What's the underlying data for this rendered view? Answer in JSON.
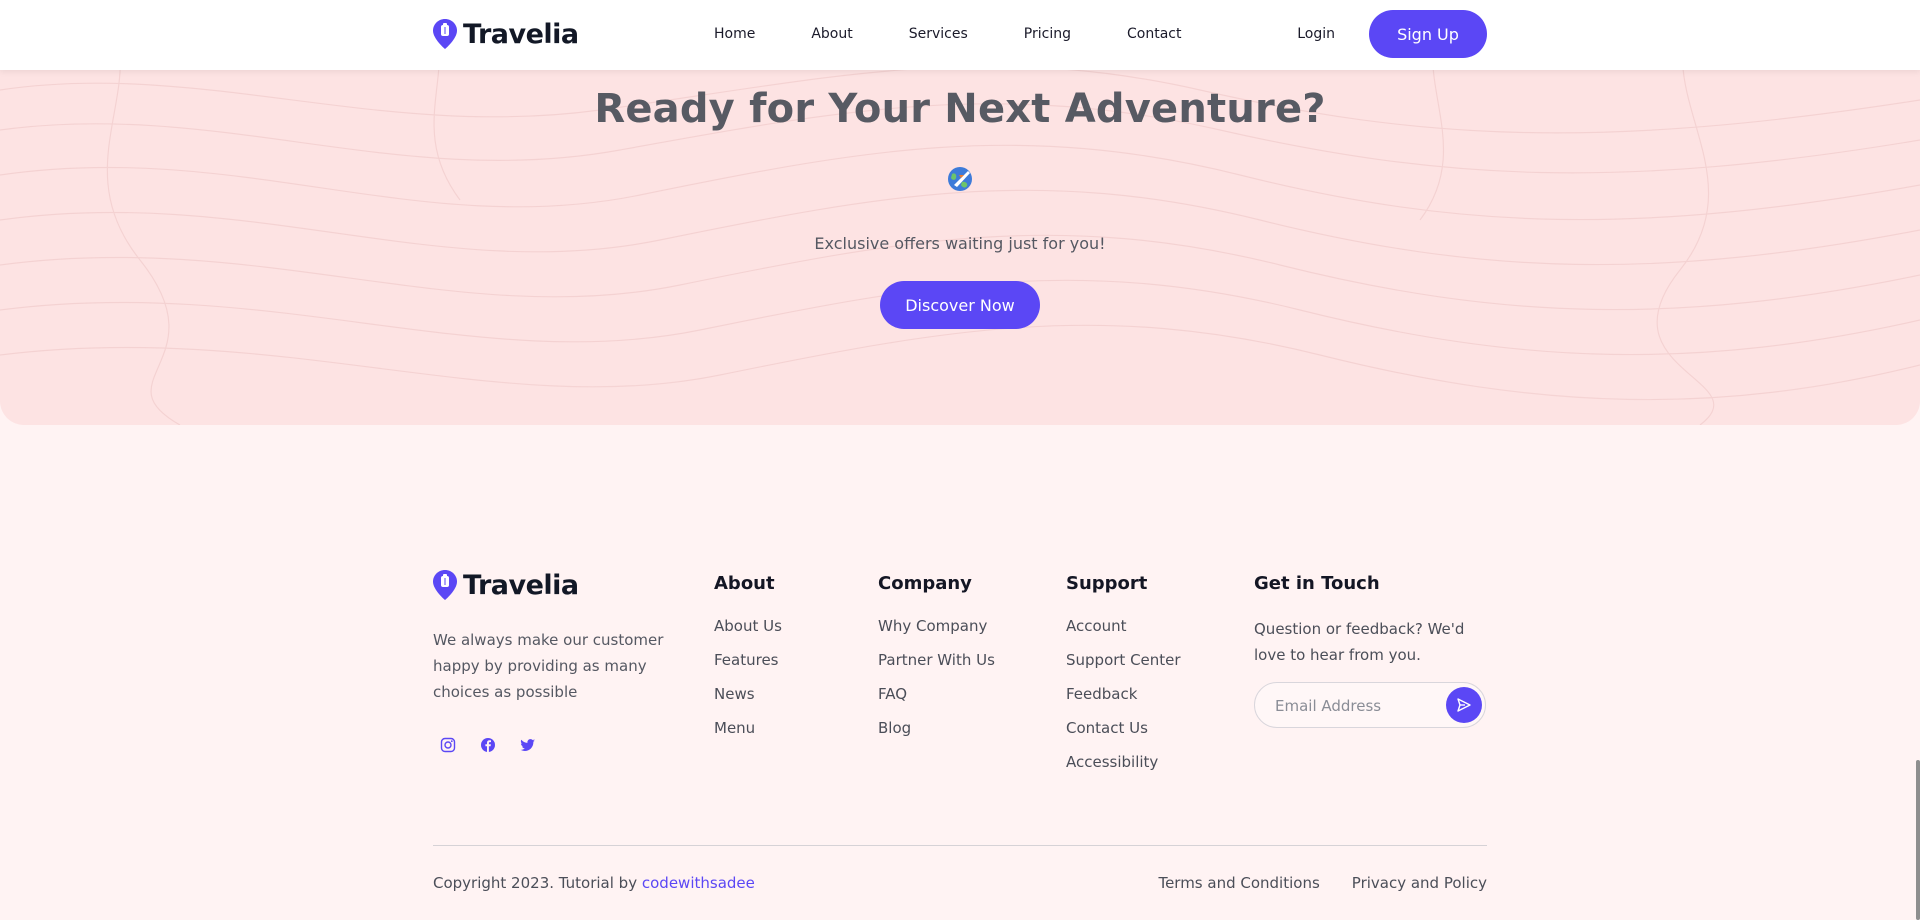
{
  "brand": {
    "name": "Travelia",
    "accent": "#5b47f5"
  },
  "header": {
    "nav": [
      "Home",
      "About",
      "Services",
      "Pricing",
      "Contact"
    ],
    "login": "Login",
    "signup": "Sign Up"
  },
  "cta": {
    "title": "Ready for Your Next Adventure?",
    "icon": "globe-airplane-icon",
    "subtitle": "Exclusive offers waiting just for you!",
    "button": "Discover Now"
  },
  "footer": {
    "description": "We always make our customer happy by providing as many choices as possible",
    "socials": [
      "instagram-icon",
      "facebook-icon",
      "twitter-icon"
    ],
    "about": {
      "title": "About",
      "links": [
        "About Us",
        "Features",
        "News",
        "Menu"
      ]
    },
    "company": {
      "title": "Company",
      "links": [
        "Why Company",
        "Partner With Us",
        "FAQ",
        "Blog"
      ]
    },
    "support": {
      "title": "Support",
      "links": [
        "Account",
        "Support Center",
        "Feedback",
        "Contact Us",
        "Accessibility"
      ]
    },
    "touch": {
      "title": "Get in Touch",
      "text": "Question or feedback? We'd love to hear from you.",
      "email_placeholder": "Email Address"
    },
    "copyright_prefix": "Copyright 2023. Tutorial by",
    "copyright_link": "codewithsadee",
    "legal": [
      "Terms and Conditions",
      "Privacy and Policy"
    ]
  }
}
